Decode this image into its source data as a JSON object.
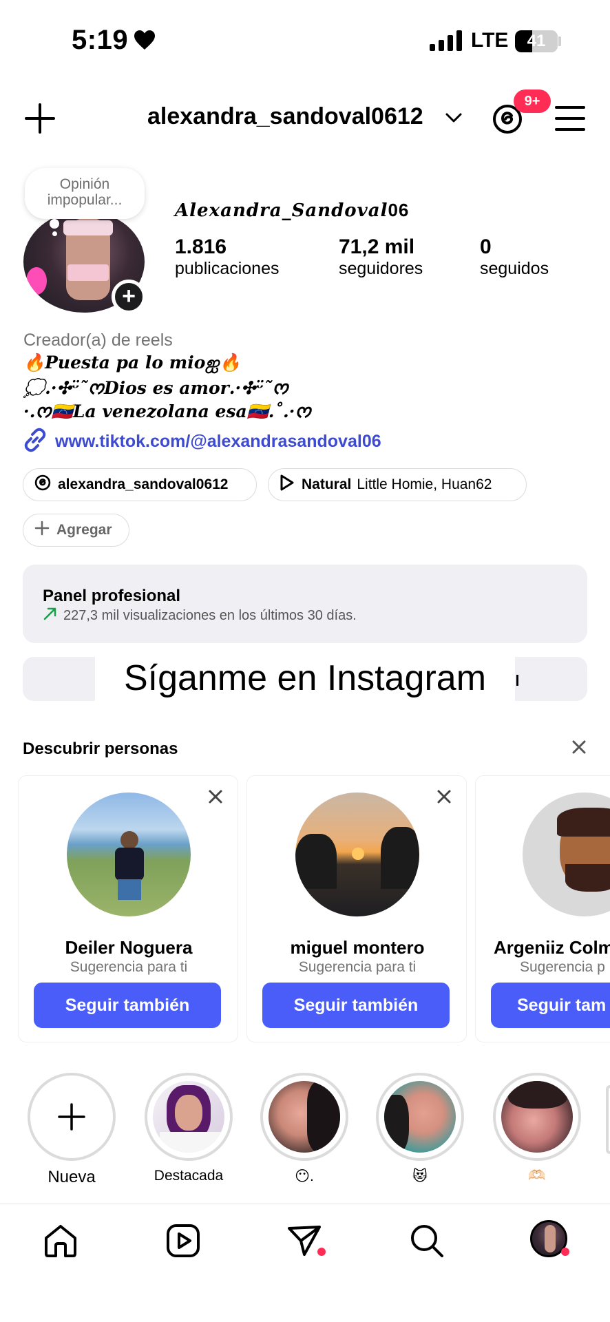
{
  "status": {
    "time": "5:19",
    "network": "LTE",
    "battery": "41",
    "battery_level": 0.41
  },
  "header": {
    "username": "alexandra_sandoval0612",
    "threads_badge": "9+"
  },
  "profile": {
    "note": "Opinión impopular...",
    "display_name_prefix": "Alexandra_Sandoval",
    "display_name_suffix": "06",
    "stats": [
      {
        "value": "1.816",
        "label": "publicaciones"
      },
      {
        "value": "71,2 mil",
        "label": "seguidores"
      },
      {
        "value": "0",
        "label": "seguidos"
      }
    ],
    "category": "Creador(a) de reels",
    "bio_lines": [
      "🔥𝑷𝒖𝒆𝒔𝒕𝒂 𝒑𝒂 𝒍𝒐 𝒎𝒊𝒐ஐ🔥",
      "💭.·✣ᵕ̈῀ᰔ𝑫𝒊𝒐𝒔 𝒆𝒔 𝒂𝒎𝒐𝒓.·✣ᵕ̈῀ᰔ",
      "·.ᰔ🇻🇪𝑳𝒂 𝒗𝒆𝒏𝒆𝒛𝒐𝒍𝒂𝒏𝒂 𝒆𝒔𝒂🇻🇪.˚.·ᰔ"
    ],
    "link": "www.tiktok.com/@alexandrasandoval06",
    "threads_pill": "alexandra_sandoval0612",
    "music_title": "Natural",
    "music_artist": "Little Homie, Huan62",
    "add_label": "Agregar"
  },
  "panel": {
    "title": "Panel profesional",
    "subtitle": "227,3 mil visualizaciones en los últimos 30 días."
  },
  "caption": "Síganme en Instagram",
  "discover": {
    "title": "Descubrir personas",
    "cards": [
      {
        "name": "Deiler Noguera",
        "subtitle": "Sugerencia para ti",
        "button": "Seguir también"
      },
      {
        "name": "miguel montero",
        "subtitle": "Sugerencia para ti",
        "button": "Seguir también"
      },
      {
        "name": "Argeniiz Colm",
        "subtitle": "Sugerencia p",
        "button": "Seguir tam"
      }
    ]
  },
  "highlights": [
    {
      "label": "Nueva"
    },
    {
      "label": "Destacada"
    },
    {
      "label": "😶."
    },
    {
      "label": "😻"
    },
    {
      "label": "🫶🏻"
    }
  ],
  "colors": {
    "accent": "#4a5df9",
    "link": "#3d4bd1",
    "badge": "#ff2d55",
    "panel": "#efeff4"
  },
  "icons": [
    "plus-icon",
    "chevron-down-icon",
    "threads-icon",
    "menu-icon",
    "link-icon",
    "play-icon",
    "trend-up-icon",
    "close-icon",
    "home-icon",
    "reels-icon",
    "send-icon",
    "search-icon"
  ]
}
